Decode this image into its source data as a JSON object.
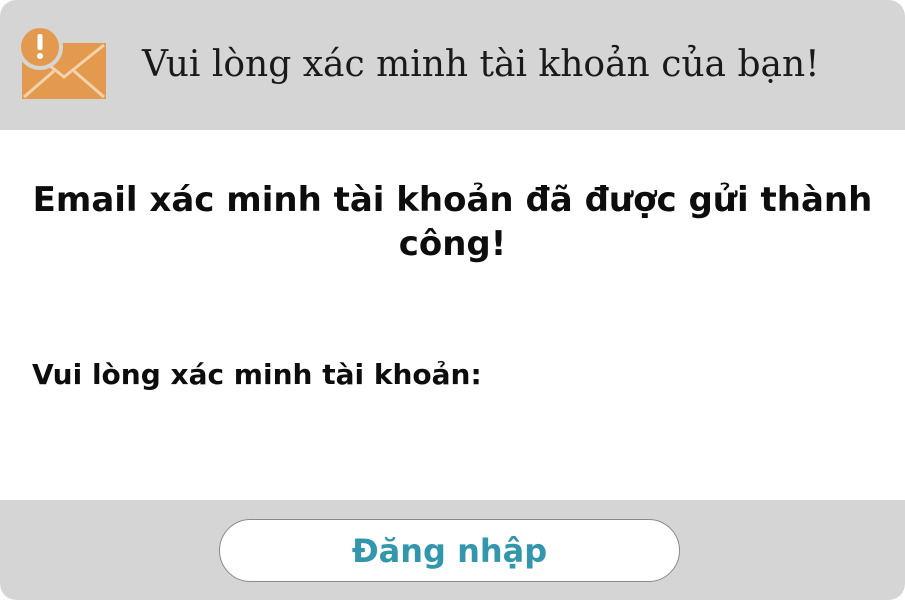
{
  "colors": {
    "header_bg": "#d5d5d5",
    "footer_bg": "#d5d5d5",
    "icon_orange": "#e39a4e",
    "button_text": "#3296ad"
  },
  "header": {
    "icon": "mail-alert-icon",
    "title": "Vui lòng xác minh tài khoản của bạn!"
  },
  "content": {
    "success_message": "Email xác minh tài khoản đã được gửi thành công!",
    "verify_label": "Vui lòng xác minh tài khoản:"
  },
  "footer": {
    "login_button_label": "Đăng nhập"
  }
}
